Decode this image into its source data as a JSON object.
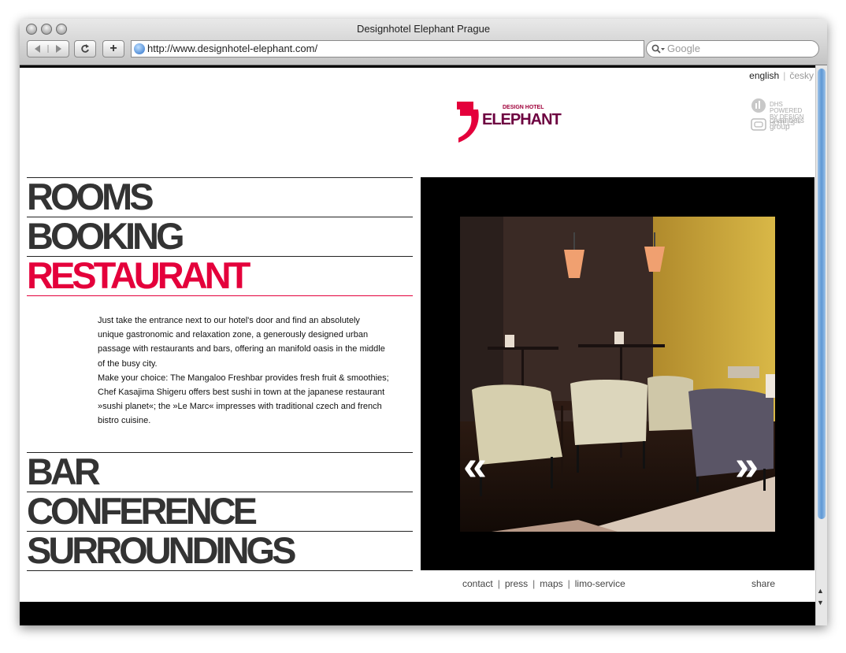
{
  "window": {
    "title": "Designhotel Elephant Prague",
    "url": "http://www.designhotel-elephant.com/",
    "search_placeholder": "Google"
  },
  "lang": {
    "english": "english",
    "czech": "česky"
  },
  "logo": {
    "small": "DESIGN HOTEL",
    "main": "ELEPHANT",
    "color": "#e4003b"
  },
  "partners": {
    "design_hotels": "DHS POWERED BY DESIGN HOTELS™",
    "chambers": "chambers group"
  },
  "nav": {
    "rooms": "ROOMS",
    "booking": "BOOKING",
    "restaurant": "RESTAURANT",
    "bar": "BAR",
    "conference": "CONFERENCE",
    "surroundings": "SURROUNDINGS"
  },
  "restaurant_text": {
    "line1": "Just take the entrance next to our hotel's door and find an absolutely",
    "line2": "unique gastronomic and relaxation zone, a generously designed urban",
    "line3": "passage with restaurants and bars, offering an manifold oasis in the middle",
    "line4": "of the busy city.",
    "line5": "Make your choice: The Mangaloo Freshbar provides fresh fruit & smoothies;",
    "line6": "Chef Kasajima Shigeru offers best sushi in town at the japanese restaurant",
    "line7": "»sushi planet«; the »Le Marc« impresses with traditional czech and french",
    "line8": "bistro cuisine."
  },
  "gallery": {
    "prev": "«",
    "next": "»"
  },
  "footer": {
    "contact": "contact",
    "press": "press",
    "maps": "maps",
    "limo": "limo-service",
    "share": "share"
  },
  "colors": {
    "accent": "#e4003b",
    "nav_text": "#333333"
  }
}
